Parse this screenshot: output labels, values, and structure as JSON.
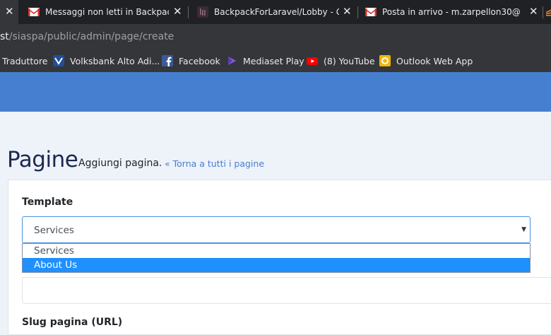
{
  "browser": {
    "tabs": [
      {
        "title": "Messaggi non letti in BackpackFo",
        "close": "✕"
      },
      {
        "title": "BackpackForLaravel/Lobby - Gitte",
        "close": "✕"
      },
      {
        "title": "Posta in arrivo - m.zarpellon30@",
        "close": "✕"
      }
    ],
    "active_tab_close": "✕",
    "url_host": "st",
    "url_path": "/siaspa/public/admin/page/create",
    "bookmarks": [
      {
        "label": "Traduttore"
      },
      {
        "label": "Volksbank Alto Adi..."
      },
      {
        "label": "Facebook"
      },
      {
        "label": "Mediaset Play"
      },
      {
        "label": "(8) YouTube"
      },
      {
        "label": "Outlook Web App"
      }
    ]
  },
  "page": {
    "title": "Pagine",
    "subtitle": "Aggiungi pagina.",
    "back_link": "« Torna a tutti i pagine"
  },
  "form": {
    "template_label": "Template",
    "template_selected": "Services",
    "template_options": [
      "Services",
      "About Us"
    ],
    "slug_label": "Slug pagina (URL)"
  },
  "colors": {
    "header": "#467fd0",
    "highlight": "#1e90ff",
    "link": "#467fd0"
  }
}
